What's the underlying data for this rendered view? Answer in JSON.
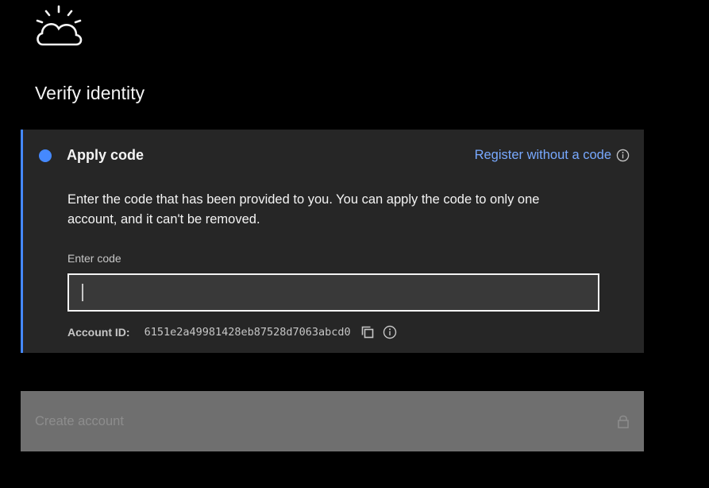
{
  "page": {
    "title": "Verify identity"
  },
  "step": {
    "title": "Apply code",
    "register_link": "Register without a code",
    "description": "Enter the code that has been provided to you. You can apply the code to only one account, and it can't be removed.",
    "field_label": "Enter code",
    "code_input_value": "",
    "account_id_label": "Account ID:",
    "account_id_value": "6151e2a49981428eb87528d7063abcd0"
  },
  "actions": {
    "create_account_label": "Create account"
  },
  "icons": {
    "logo": "ibm-cloud-logo-icon",
    "info": "info-icon",
    "copy": "copy-icon",
    "lock": "lock-icon"
  },
  "colors": {
    "background": "#000000",
    "panel": "#262626",
    "accent": "#4589ff",
    "link": "#78a9ff",
    "disabled_button": "#6f6f6f"
  }
}
